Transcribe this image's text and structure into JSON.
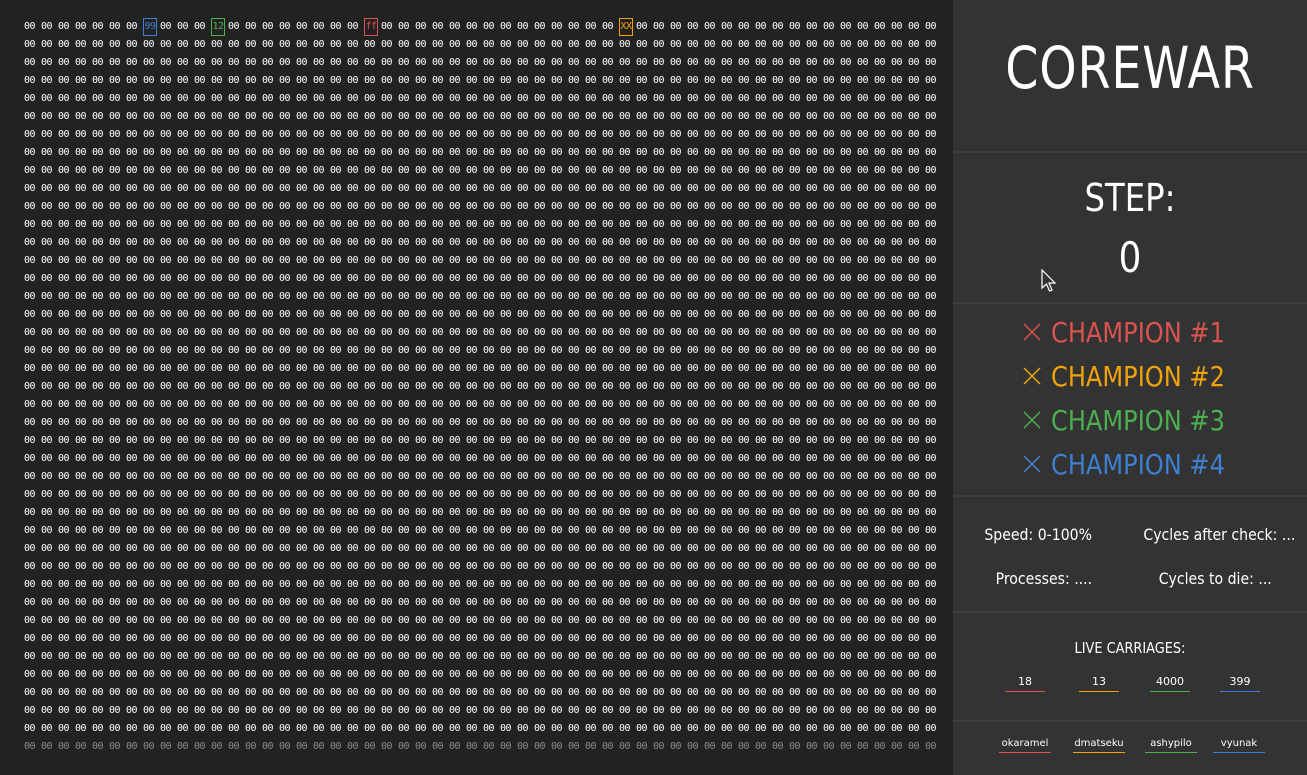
{
  "arena": {
    "rows": 41,
    "cols": 54,
    "default_byte": "00",
    "markers": [
      {
        "row": 0,
        "col": 7,
        "text": "99",
        "color": "#3d7fd0"
      },
      {
        "row": 0,
        "col": 11,
        "text": "12",
        "color": "#4caf50"
      },
      {
        "row": 0,
        "col": 20,
        "text": "ff",
        "color": "#d9534f"
      },
      {
        "row": 0,
        "col": 35,
        "text": "XX",
        "color": "#f0a30a"
      }
    ]
  },
  "panel": {
    "title": "COREWAR",
    "step_label": "STEP:",
    "step_value": "0",
    "champions": [
      {
        "label": "CHAMPION #1",
        "color": "#d9534f",
        "icon": "close-icon"
      },
      {
        "label": "CHAMPION #2",
        "color": "#f0a30a",
        "icon": "close-icon"
      },
      {
        "label": "CHAMPION #3",
        "color": "#4caf50",
        "icon": "close-icon"
      },
      {
        "label": "CHAMPION #4",
        "color": "#3d7fd0",
        "icon": "close-icon"
      }
    ],
    "stats": {
      "speed": "Speed: 0-100%",
      "cycles_after_check": "Cycles after check: ...",
      "processes": "Processes: ....",
      "cycles_to_die": "Cycles to die: ..."
    },
    "live_carriages": {
      "title": "LIVE CARRIAGES:",
      "values": [
        "18",
        "13",
        "4000",
        "399"
      ]
    },
    "players": [
      "okaramel",
      "dmatseku",
      "ashypilo",
      "vyunak"
    ]
  }
}
